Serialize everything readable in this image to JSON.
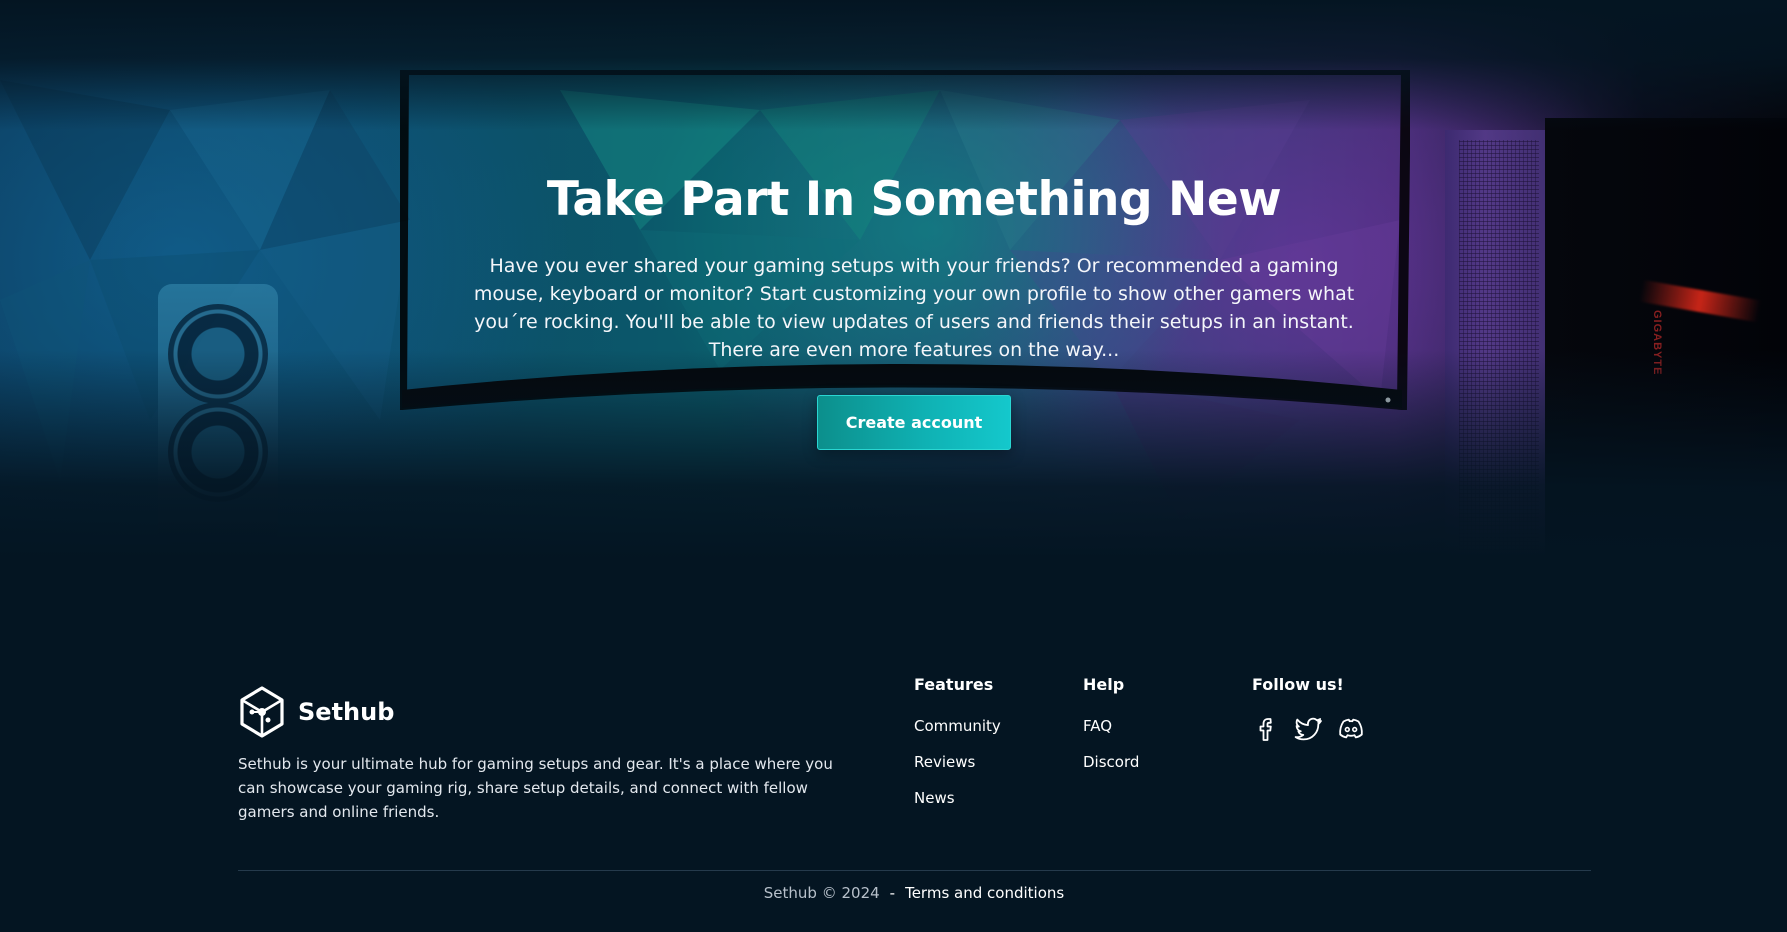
{
  "hero": {
    "title": "Take Part In Something New",
    "description": "Have you ever shared your gaming setups with your friends? Or recommended a gaming mouse, keyboard or monitor? Start customizing your own profile to show other gamers what you´re rocking. You'll be able to view updates of users and friends their setups in an instant. There are even more features on the way...",
    "cta_label": "Create account",
    "case_brand": "GIGABYTE"
  },
  "footer": {
    "brand_name": "Sethub",
    "brand_description": "Sethub is your ultimate hub for gaming setups and gear. It's a place where you can showcase your gaming rig, share setup details, and connect with fellow gamers and online friends.",
    "columns": [
      {
        "title": "Features",
        "links": [
          "Community",
          "Reviews",
          "News"
        ]
      },
      {
        "title": "Help",
        "links": [
          "FAQ",
          "Discord"
        ]
      },
      {
        "title": "Follow us!",
        "social": [
          "facebook-icon",
          "twitter-icon",
          "discord-icon"
        ]
      }
    ],
    "copyright": "Sethub © 2024",
    "separator": "-",
    "terms_label": "Terms and conditions"
  },
  "colors": {
    "background": "#041522",
    "accent": "#0fb1b3",
    "divider": "#253a4c"
  }
}
